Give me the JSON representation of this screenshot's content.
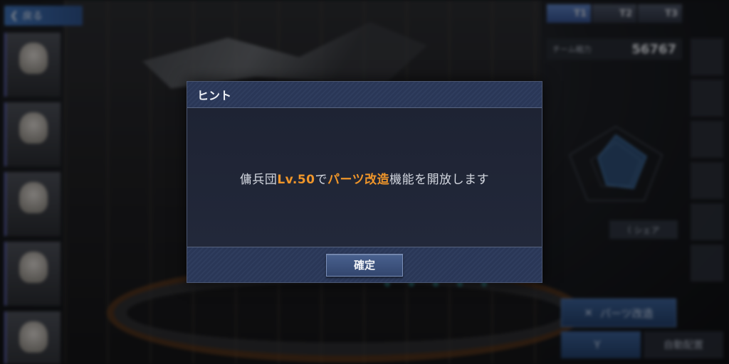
{
  "back_button": {
    "label": "戻る"
  },
  "roster": [
    {
      "tag": "",
      "label": ""
    },
    {
      "tag": "",
      "label": ""
    },
    {
      "tag": "",
      "label": ""
    },
    {
      "tag": "",
      "label": ""
    },
    {
      "tag": "",
      "label": ""
    }
  ],
  "team_tabs": [
    "T1",
    "T2",
    "T3"
  ],
  "team_power": {
    "label": "チーム戦力",
    "value": "56767"
  },
  "side_icons": [
    "",
    "",
    "",
    "",
    "",
    "",
    ""
  ],
  "share_label": "シェア",
  "parts_button": {
    "label": "パーツ改造"
  },
  "equip_button": {
    "label": ""
  },
  "auto_deploy_button": {
    "label": "自動配置"
  },
  "dialog": {
    "title": "ヒント",
    "message_parts": [
      "傭兵団",
      "Lv.50",
      "で",
      "パーツ改造",
      "機能を開放します"
    ],
    "highlight_color": "#f0962a",
    "confirm_label": "確定"
  }
}
